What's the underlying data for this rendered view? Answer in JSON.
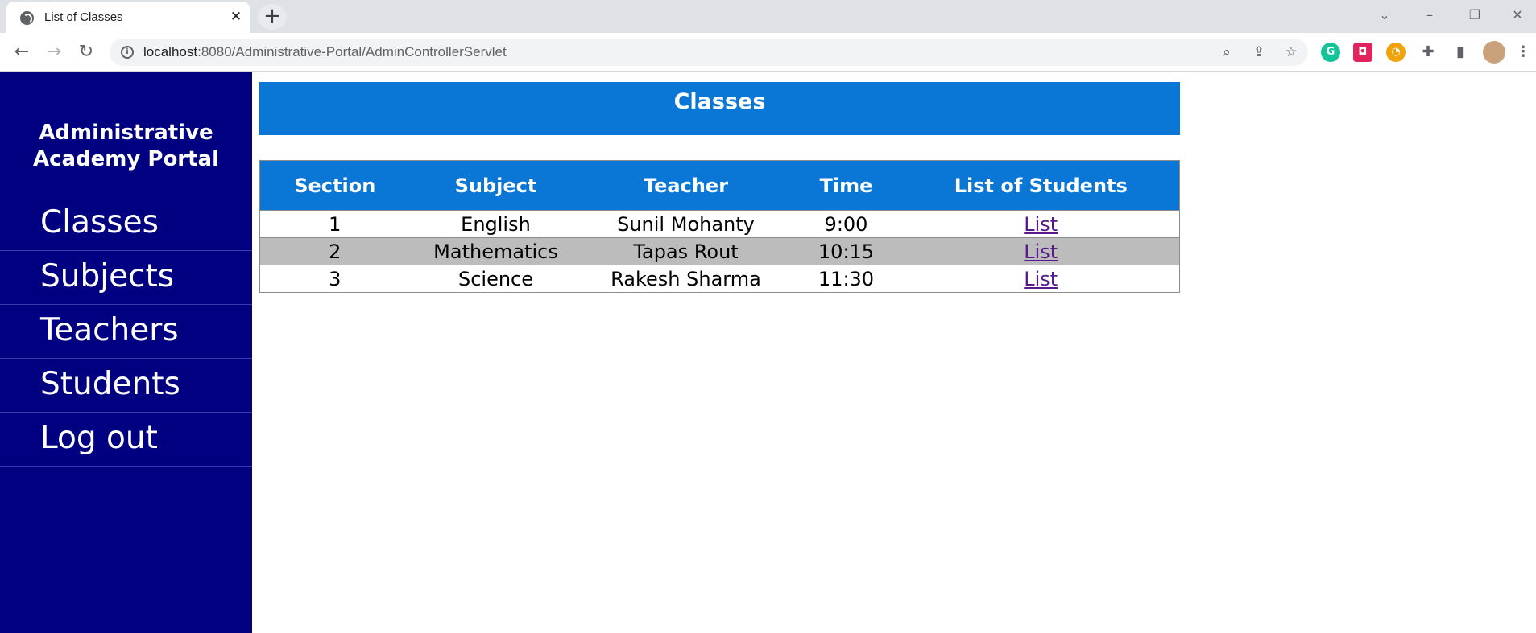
{
  "browser": {
    "tab_title": "List of Classes",
    "url_host": "localhost",
    "url_rest": ":8080/Administrative-Portal/AdminControllerServlet"
  },
  "sidebar": {
    "brand_line1": "Administrative",
    "brand_line2": "Academy Portal",
    "items": [
      {
        "label": "Classes"
      },
      {
        "label": "Subjects"
      },
      {
        "label": "Teachers"
      },
      {
        "label": "Students"
      },
      {
        "label": "Log out"
      }
    ]
  },
  "main": {
    "title": "Classes",
    "table": {
      "headers": [
        "Section",
        "Subject",
        "Teacher",
        "Time",
        "List of Students"
      ],
      "rows": [
        {
          "section": "1",
          "subject": "English",
          "teacher": "Sunil Mohanty",
          "time": "9:00",
          "link": "List"
        },
        {
          "section": "2",
          "subject": "Mathematics",
          "teacher": "Tapas Rout",
          "time": "10:15",
          "link": "List"
        },
        {
          "section": "3",
          "subject": "Science",
          "teacher": "Rakesh Sharma",
          "time": "11:30",
          "link": "List"
        }
      ]
    }
  },
  "colors": {
    "sidebar_bg": "#000080",
    "header_bg": "#0a76d6",
    "alt_row_bg": "#bcbcbc",
    "link": "#551a8b"
  },
  "icons": {
    "tab": "globe-icon",
    "close": "close-icon",
    "new_tab": "plus-icon",
    "back": "back-arrow-icon",
    "forward": "forward-arrow-icon",
    "reload": "reload-icon",
    "info": "info-icon",
    "zoom": "zoom-icon",
    "share": "share-icon",
    "star": "star-icon",
    "extensions": "puzzle-icon",
    "side_panel": "side-panel-icon",
    "menu": "kebab-menu-icon"
  }
}
